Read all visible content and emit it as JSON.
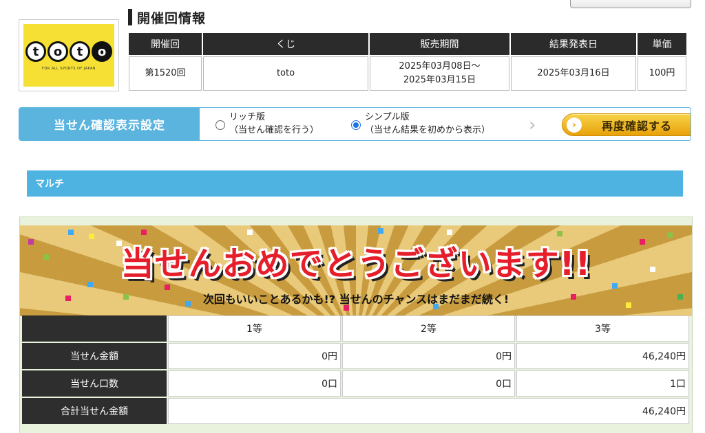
{
  "section_title": "開催回情報",
  "logo": {
    "letters": [
      "t",
      "o",
      "t",
      "o"
    ],
    "tagline": "FOR ALL SPORTS OF JAPAN"
  },
  "info_table": {
    "headers": [
      "開催回",
      "くじ",
      "販売期間",
      "結果発表日",
      "単価"
    ],
    "round": "第1520回",
    "lottery": "toto",
    "sale_period_start": "2025年03月08日〜",
    "sale_period_end": "2025年03月15日",
    "result_date": "2025年03月16日",
    "price": "100円"
  },
  "display_settings": {
    "label": "当せん確認表示設定",
    "options": [
      {
        "title": "リッチ版",
        "desc": "（当せん確認を行う）",
        "checked": false
      },
      {
        "title": "シンプル版",
        "desc": "（当せん結果を初めから表示）",
        "checked": true
      }
    ],
    "recheck_button": "再度確認する"
  },
  "multi_label": "マルチ",
  "banner": {
    "title": "当せんおめでとうございます!!",
    "subtitle": "次回もいいことあるかも!? 当せんのチャンスはまだまだ続く!"
  },
  "prize_table": {
    "grades": [
      "1等",
      "2等",
      "3等"
    ],
    "rows": [
      {
        "label": "当せん金額",
        "values": [
          "0円",
          "0円",
          "46,240円"
        ]
      },
      {
        "label": "当せん口数",
        "values": [
          "0口",
          "0口",
          "1口"
        ]
      }
    ],
    "total_label": "合計当せん金額",
    "total_value": "46,240円"
  },
  "colors": {
    "accent_blue": "#4fb3e1",
    "button_gold": "#f2b92b",
    "banner_red": "#e61e2b",
    "logo_yellow": "#f5e033",
    "header_dark": "#2b2b2b"
  }
}
